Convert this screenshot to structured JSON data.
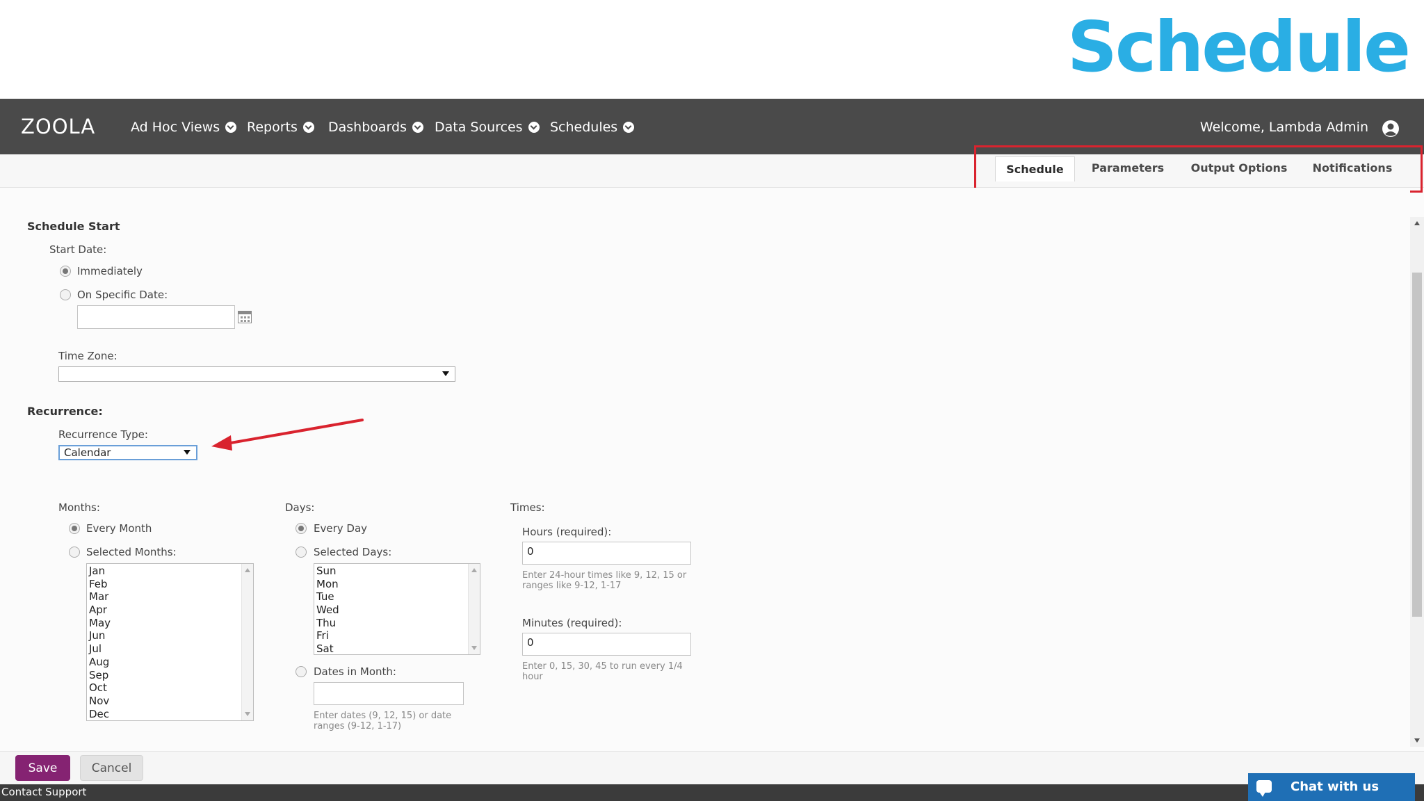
{
  "overlay": {
    "title": "Schedule"
  },
  "nav": {
    "logo": "ZOOLA",
    "items": [
      {
        "label": "Ad Hoc Views"
      },
      {
        "label": "Reports"
      },
      {
        "label": "Dashboards"
      },
      {
        "label": "Data Sources"
      },
      {
        "label": "Schedules"
      }
    ],
    "welcome": "Welcome, Lambda Admin"
  },
  "tabs": [
    {
      "label": "Schedule",
      "active": true
    },
    {
      "label": "Parameters",
      "active": false
    },
    {
      "label": "Output Options",
      "active": false
    },
    {
      "label": "Notifications",
      "active": false
    }
  ],
  "schedule_start": {
    "heading": "Schedule Start",
    "start_date_label": "Start Date:",
    "immediately_label": "Immediately",
    "specific_date_label": "On Specific Date:",
    "specific_date_value": "",
    "time_zone_label": "Time Zone:",
    "time_zone_value": ""
  },
  "recurrence": {
    "heading": "Recurrence:",
    "type_label": "Recurrence Type:",
    "type_value": "Calendar"
  },
  "months": {
    "label": "Months:",
    "every_label": "Every Month",
    "selected_label": "Selected Months:",
    "options": [
      "Jan",
      "Feb",
      "Mar",
      "Apr",
      "May",
      "Jun",
      "Jul",
      "Aug",
      "Sep",
      "Oct",
      "Nov",
      "Dec"
    ]
  },
  "days": {
    "label": "Days:",
    "every_label": "Every Day",
    "selected_label": "Selected Days:",
    "options": [
      "Sun",
      "Mon",
      "Tue",
      "Wed",
      "Thu",
      "Fri",
      "Sat"
    ],
    "dates_label": "Dates in Month:",
    "dates_value": "",
    "dates_hint": "Enter dates (9, 12, 15) or date ranges (9-12, 1-17)"
  },
  "times": {
    "label": "Times:",
    "hours_label": "Hours (required):",
    "hours_value": "0",
    "hours_hint": "Enter 24-hour times like 9, 12, 15 or ranges like 9-12, 1-17",
    "minutes_label": "Minutes (required):",
    "minutes_value": "0",
    "minutes_hint": "Enter 0, 15, 30, 45 to run every 1/4 hour"
  },
  "footer": {
    "save_label": "Save",
    "cancel_label": "Cancel",
    "contact_label": "Contact Support",
    "chat_label": "Chat with us"
  },
  "colors": {
    "brand_blue": "#2aaee4",
    "navbar": "#4a4a4a",
    "save": "#852372",
    "highlight": "#d9232e",
    "chat": "#1f6fb5"
  }
}
